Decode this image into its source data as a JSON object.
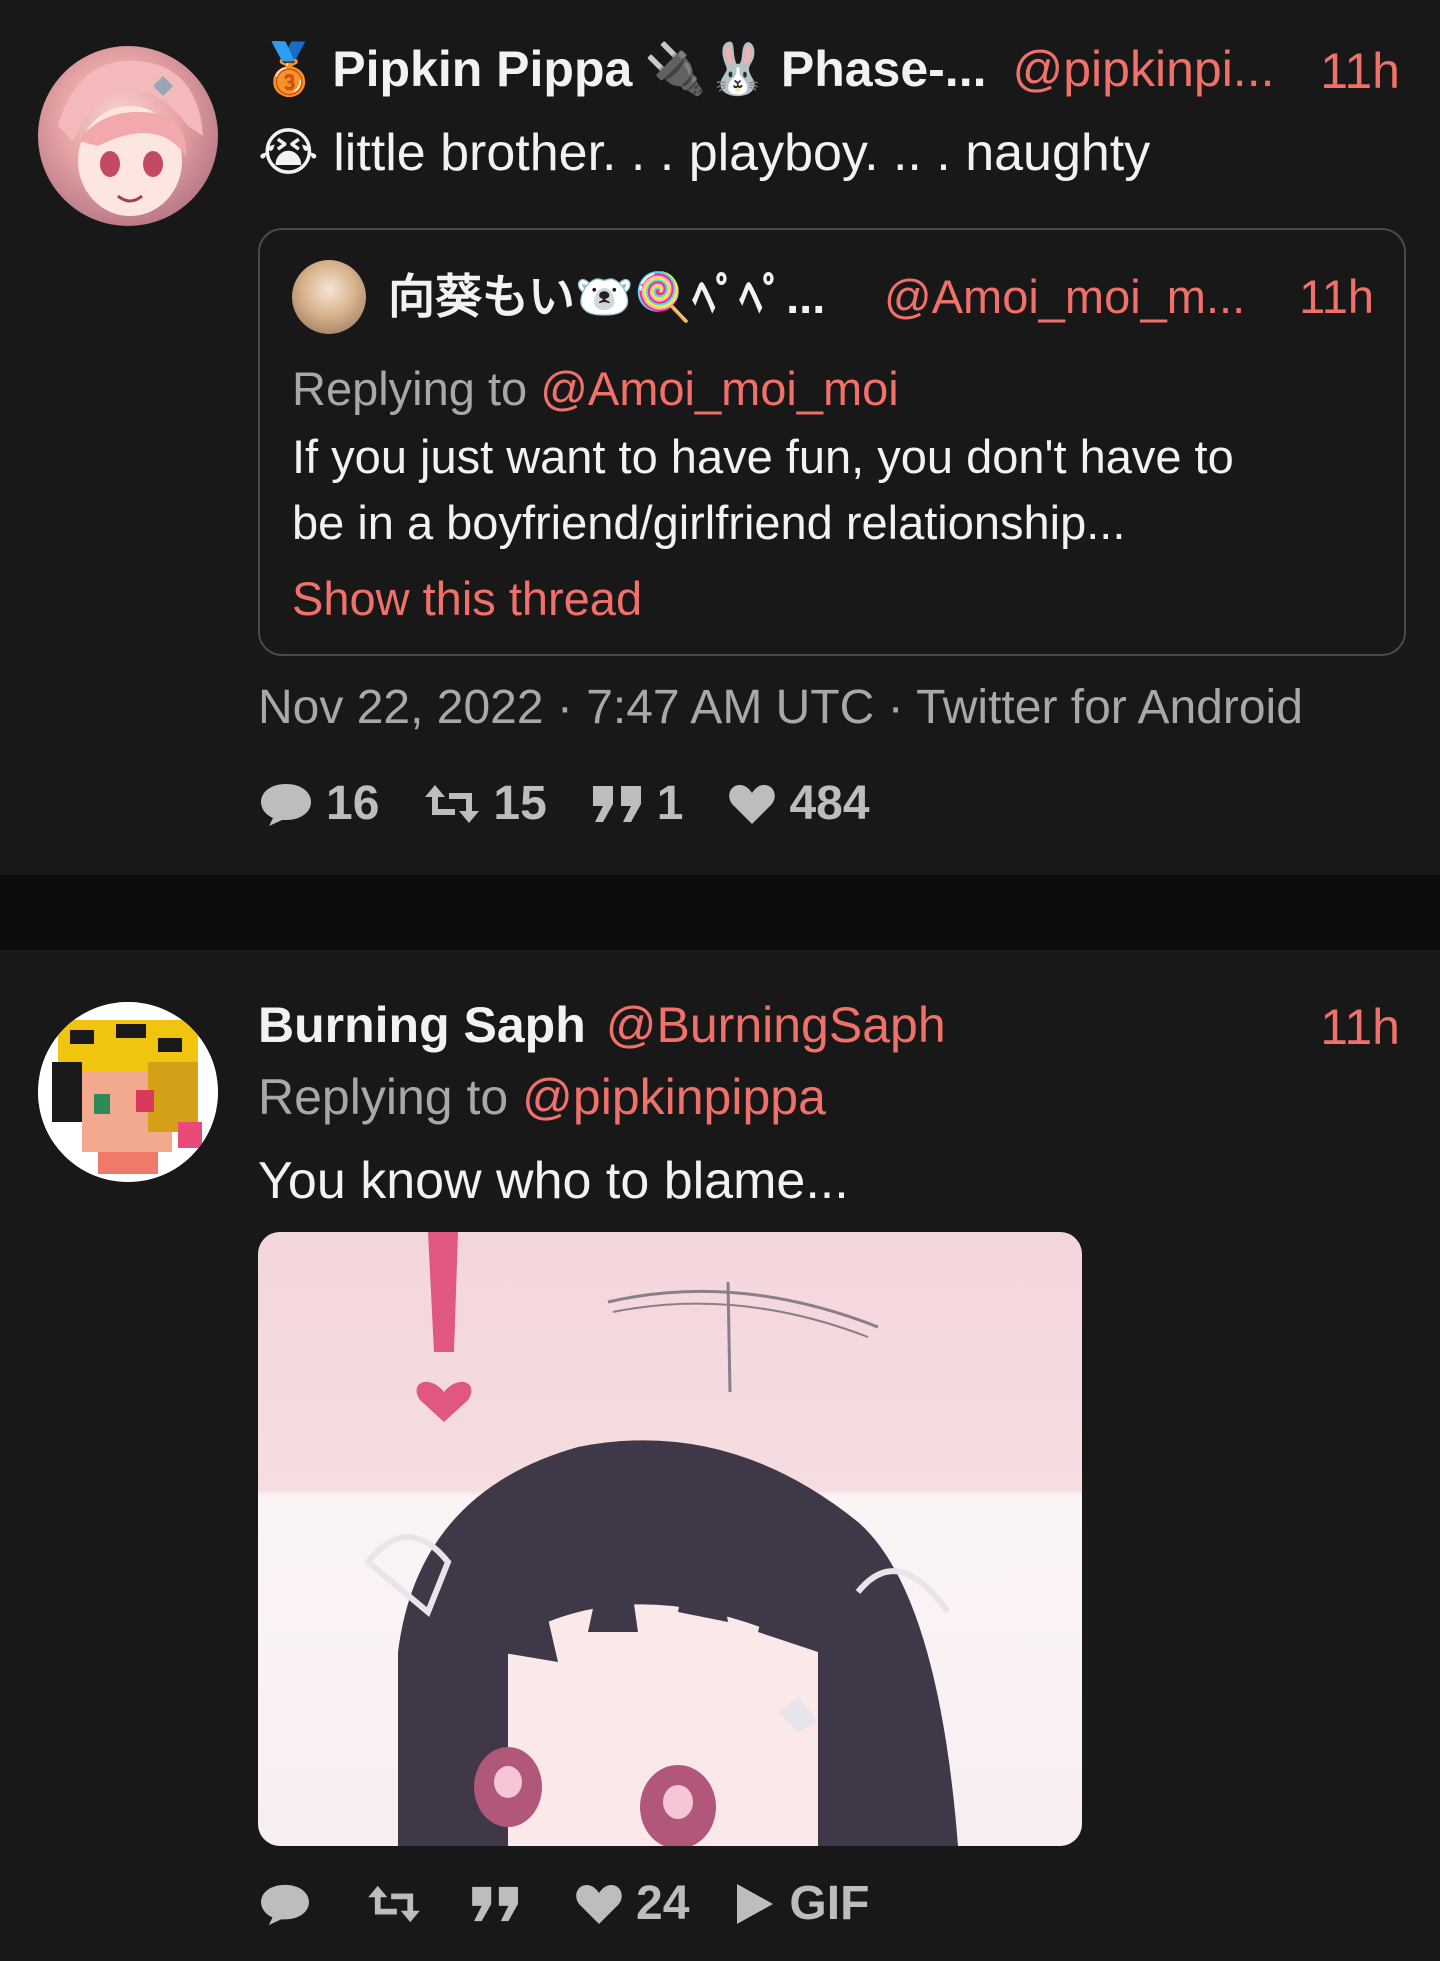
{
  "tweets": [
    {
      "author": {
        "badge": "🥉",
        "name": "Pipkin Pippa",
        "extra_emoji": "🔌🐰",
        "extra_name": "Phase-...",
        "handle": "@pipkinpi...",
        "time": "11h"
      },
      "text": "😭 little brother. . . playboy. .. . naughty",
      "quote": {
        "name": "向葵もい🐻‍❄️🍭ﾍﾟﾍﾟ...",
        "handle": "@Amoi_moi_m...",
        "time": "11h",
        "replying_prefix": "Replying to",
        "replying_handle": "@Amoi_moi_moi",
        "text_line1": "If you just want to have fun, you don't have to",
        "text_line2": "be in a boyfriend/girlfriend relationship...",
        "show_thread": "Show this thread"
      },
      "meta": "Nov 22, 2022 · 7:47 AM UTC · Twitter for Android",
      "stats": {
        "replies": "16",
        "retweets": "15",
        "quotes": "1",
        "likes": "484"
      }
    },
    {
      "author": {
        "name": "Burning Saph",
        "handle": "@BurningSaph",
        "time": "11h"
      },
      "replying_prefix": "Replying to",
      "replying_handle": "@pipkinpippa",
      "text": "You know who to blame...",
      "stats": {
        "likes": "24",
        "media_label": "GIF"
      }
    }
  ],
  "colors": {
    "accent": "#f0706a",
    "background": "#181818",
    "separator": "#0c0c0c",
    "muted": "#a8a8a8"
  }
}
